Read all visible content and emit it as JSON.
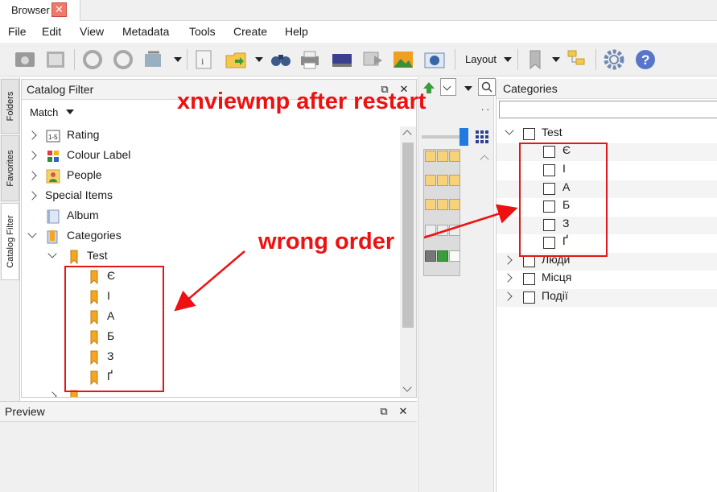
{
  "window": {
    "tab_title": "Browser",
    "close_glyph": "✕"
  },
  "menu": [
    "File",
    "Edit",
    "View",
    "Metadata",
    "Tools",
    "Create",
    "Help"
  ],
  "toolbar": {
    "layout_label": "Layout"
  },
  "sidetabs": [
    "Folders",
    "Favorites",
    "Catalog Filter"
  ],
  "catalog_filter": {
    "title": "Catalog Filter",
    "match_label": "Match",
    "items": [
      {
        "label": "Rating",
        "icon": "rating-icon"
      },
      {
        "label": "Colour Label",
        "icon": "colour-label-icon"
      },
      {
        "label": "People",
        "icon": "people-icon"
      },
      {
        "label": "Special Items",
        "icon": ""
      },
      {
        "label": "Album",
        "icon": "album-icon"
      },
      {
        "label": "Categories",
        "icon": "categories-icon"
      }
    ],
    "categories_child": "Test",
    "test_children": [
      "Є",
      "І",
      "А",
      "Б",
      "З",
      "Ґ"
    ]
  },
  "preview": {
    "title": "Preview"
  },
  "categories_panel": {
    "title": "Categories",
    "root": "Test",
    "test_children": [
      "Є",
      "І",
      "А",
      "Б",
      "З",
      "Ґ"
    ],
    "others": [
      "Люди",
      "Місця",
      "Події"
    ]
  },
  "annotations": {
    "title": "xnviewmp after restart",
    "wrong_order": "wrong order"
  },
  "colors": {
    "annotation": "#ee1111",
    "accent": "#1f7be0"
  }
}
